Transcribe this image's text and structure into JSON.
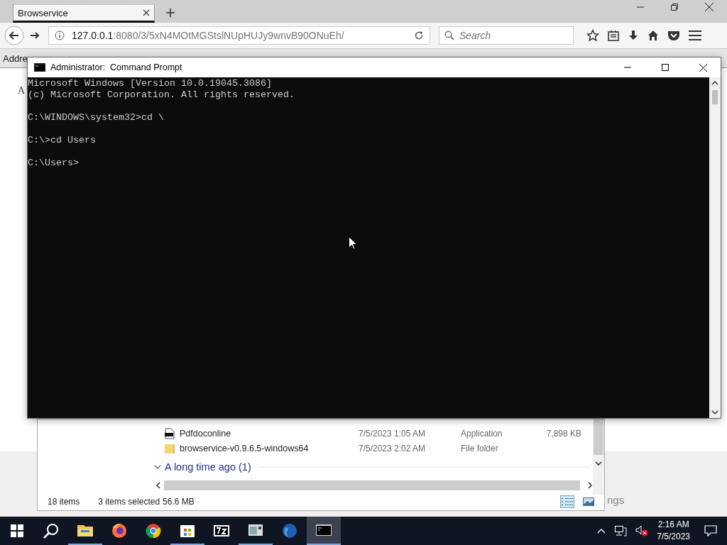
{
  "browser": {
    "tabs": [
      {
        "title": "Browservice",
        "selected": true
      }
    ],
    "url": {
      "host": "127.0.0.1",
      "path": ":8080/3/5xN4MOtMGStslNUpHUJy9wnvB90ONuEh/"
    },
    "search": {
      "placeholder": "Search"
    },
    "page": {
      "address_label": "Addre",
      "left_text": "A",
      "right_text": "ngs"
    }
  },
  "command_prompt": {
    "title": "Administrator:  Command Prompt",
    "output_blocks": [
      [
        "Microsoft Windows [Version 10.0.19045.3086]",
        "(c) Microsoft Corporation. All rights reserved."
      ],
      [
        "C:\\WINDOWS\\system32>cd \\"
      ],
      [
        "C:\\>cd Users"
      ],
      [
        "C:\\Users>"
      ]
    ]
  },
  "explorer": {
    "rows": [
      {
        "kind": "application",
        "name": "Pdfdoconline",
        "date": "7/5/2023 1:05 AM",
        "type": "Application",
        "size": "7,898 KB"
      },
      {
        "kind": "folder",
        "name": "browservice-v0.9.6.5-windows64",
        "date": "7/5/2023 2:02 AM",
        "type": "File folder"
      }
    ],
    "group": {
      "label": "A long time ago (1)",
      "expanded": true
    },
    "status": {
      "count": "18 items",
      "selected": "3 items selected",
      "size": "56.6 MB"
    },
    "views": [
      {
        "kind": "details",
        "selected": true
      },
      {
        "kind": "tiles",
        "selected": false
      }
    ]
  },
  "taskbar": {
    "apps": [
      {
        "kind": "folder",
        "running": true,
        "selected": false
      },
      {
        "kind": "firefox",
        "running": false,
        "selected": false
      },
      {
        "kind": "chrome",
        "running": false,
        "selected": false
      },
      {
        "kind": "store",
        "running": true,
        "selected": false
      },
      {
        "kind": "sevenzip",
        "running": false,
        "selected": false
      },
      {
        "kind": "window",
        "running": true,
        "selected": false
      },
      {
        "kind": "globe",
        "running": false,
        "selected": false
      },
      {
        "kind": "console",
        "running": true,
        "selected": true
      }
    ],
    "time": "2:16 AM",
    "date": "7/5/2023"
  }
}
